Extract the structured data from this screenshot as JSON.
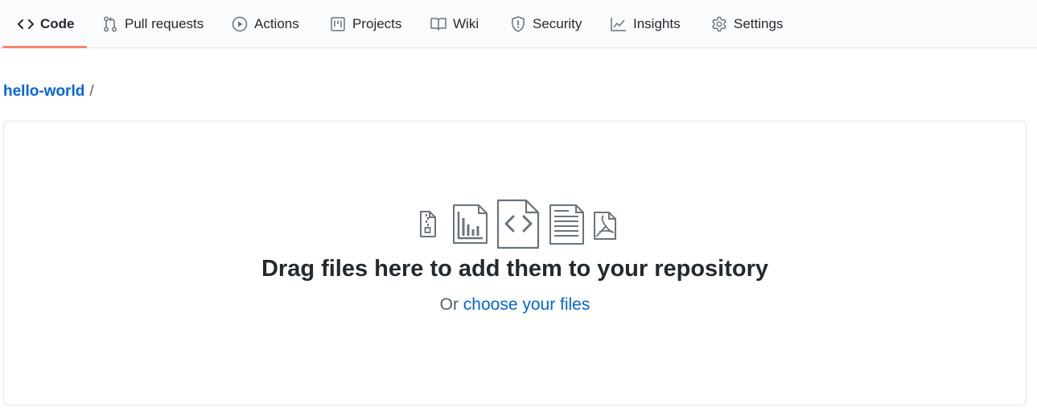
{
  "tabs": [
    {
      "label": "Code",
      "icon": "code-icon",
      "active": true
    },
    {
      "label": "Pull requests",
      "icon": "pull-request-icon"
    },
    {
      "label": "Actions",
      "icon": "play-icon"
    },
    {
      "label": "Projects",
      "icon": "project-icon"
    },
    {
      "label": "Wiki",
      "icon": "book-icon"
    },
    {
      "label": "Security",
      "icon": "shield-icon"
    },
    {
      "label": "Insights",
      "icon": "graph-icon"
    },
    {
      "label": "Settings",
      "icon": "gear-icon"
    }
  ],
  "breadcrumb": {
    "repo": "hello-world",
    "separator": "/"
  },
  "dropzone": {
    "file_icons": [
      "file-zip-icon",
      "file-chart-icon",
      "file-code-icon",
      "file-text-icon",
      "file-pdf-icon"
    ],
    "headline": "Drag files here to add them to your repository",
    "or_text": "Or",
    "choose_link": "choose your files"
  },
  "colors": {
    "accent_link": "#0366d6",
    "tab_underline": "#f9826c",
    "text": "#24292e",
    "muted": "#586069"
  }
}
